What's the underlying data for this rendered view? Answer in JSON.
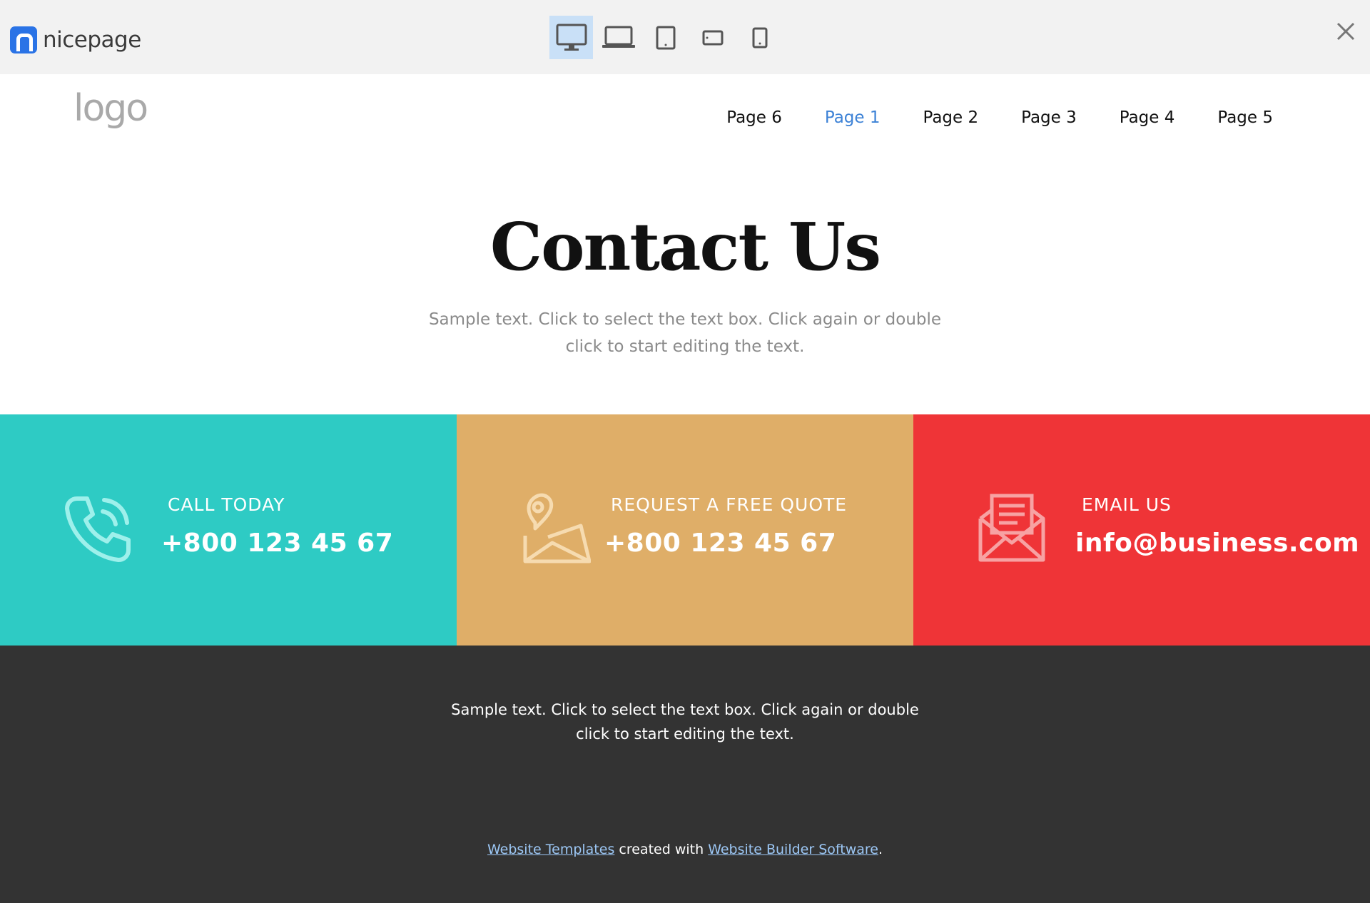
{
  "toolbar": {
    "brand_name": "nicepage",
    "device_buttons": [
      {
        "name": "desktop",
        "active": true
      },
      {
        "name": "laptop",
        "active": false
      },
      {
        "name": "tablet",
        "active": false
      },
      {
        "name": "phone-landscape",
        "active": false
      },
      {
        "name": "phone",
        "active": false
      }
    ],
    "active_color": "#c9e0f7",
    "brand_color": "#2a73e6"
  },
  "header": {
    "logo": "logo",
    "nav": [
      {
        "label": "Page 6",
        "active": false
      },
      {
        "label": "Page 1",
        "active": true
      },
      {
        "label": "Page 2",
        "active": false
      },
      {
        "label": "Page 3",
        "active": false
      },
      {
        "label": "Page 4",
        "active": false
      },
      {
        "label": "Page 5",
        "active": false
      }
    ],
    "active_color": "#3d82d6"
  },
  "hero": {
    "title": "Contact Us",
    "text": "Sample text. Click to select the text box. Click again or double click to start editing the text."
  },
  "cards": [
    {
      "icon": "phone-icon",
      "label": "CALL TODAY",
      "value": "+800 123 45 67",
      "color": "#2ecbc4"
    },
    {
      "icon": "map-pin-icon",
      "label": "REQUEST A FREE QUOTE",
      "value": "+800 123 45 67",
      "color": "#dfae68"
    },
    {
      "icon": "envelope-icon",
      "label": "EMAIL US",
      "value": "info@business.com",
      "color": "#ef3437"
    }
  ],
  "footer": {
    "text": "Sample text. Click to select the text box. Click again or double click to start editing the text.",
    "credit_link1": "Website Templates",
    "credit_middle": "created with",
    "credit_link2": "Website Builder Software",
    "credit_end": ".",
    "background": "#333333",
    "link_color": "#9cc7f5"
  }
}
